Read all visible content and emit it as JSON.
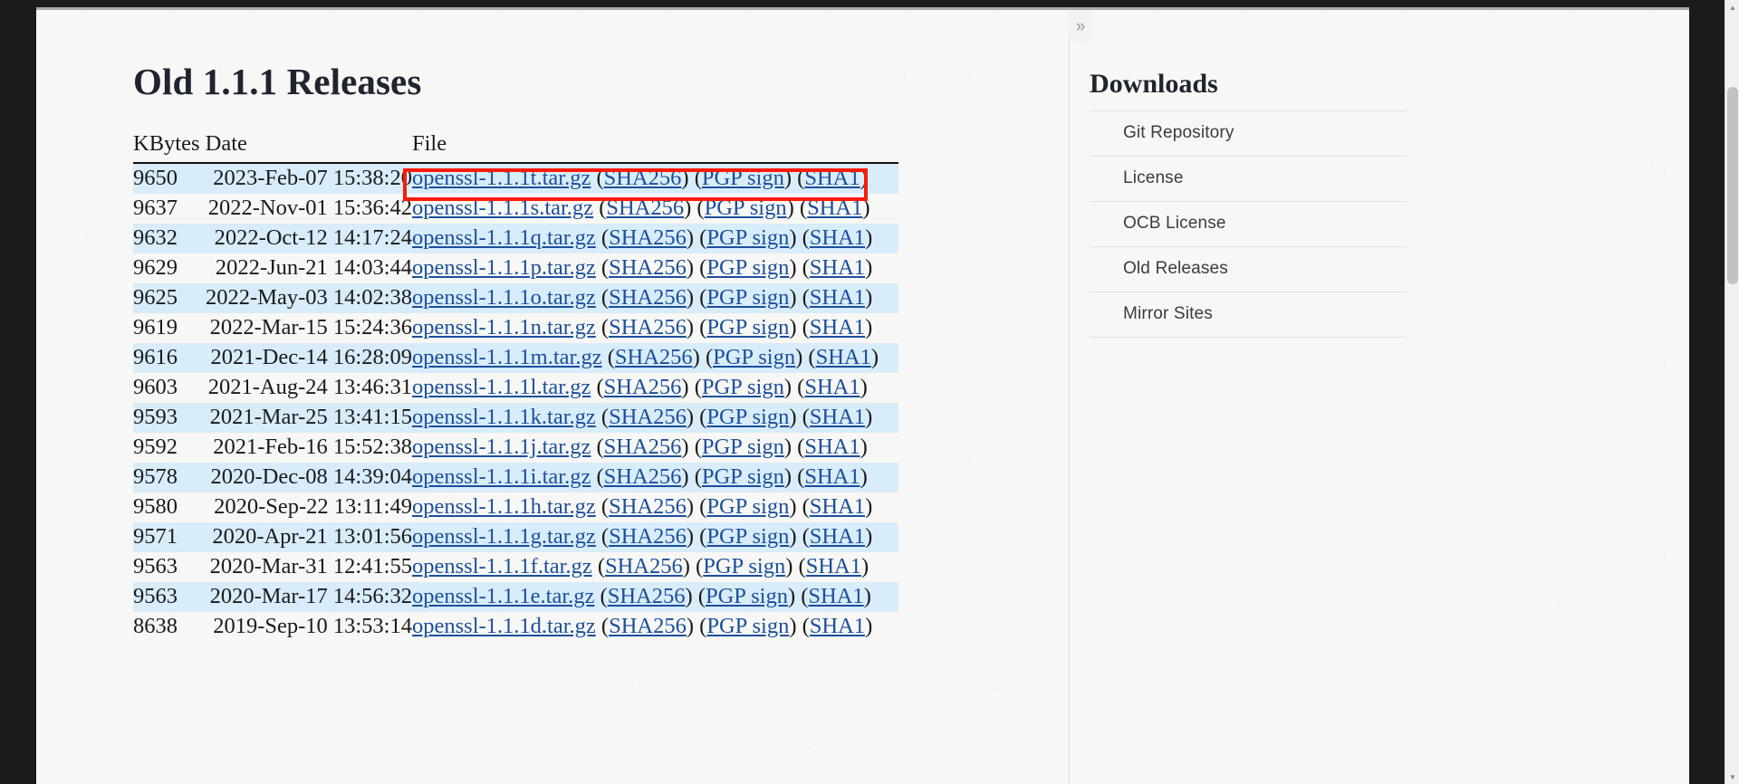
{
  "window": {
    "sidebar_toggle_glyph": "»",
    "scroll_up_glyph": "▲",
    "scroll_down_glyph": "▼"
  },
  "main": {
    "title": "Old 1.1.1 Releases",
    "table": {
      "headers": {
        "kbytes_date": "KBytes Date",
        "file": "File"
      },
      "link_labels": {
        "sha256": "(SHA256)",
        "pgp_sign": "(PGP sign)",
        "sha1": "(SHA1)"
      },
      "rows": [
        {
          "kbytes": "9650",
          "date": "2023-Feb-07 15:38:20",
          "file": "openssl-1.1.1t.tar.gz"
        },
        {
          "kbytes": "9637",
          "date": "2022-Nov-01 15:36:42",
          "file": "openssl-1.1.1s.tar.gz"
        },
        {
          "kbytes": "9632",
          "date": "2022-Oct-12 14:17:24",
          "file": "openssl-1.1.1q.tar.gz"
        },
        {
          "kbytes": "9629",
          "date": "2022-Jun-21 14:03:44",
          "file": "openssl-1.1.1p.tar.gz"
        },
        {
          "kbytes": "9625",
          "date": "2022-May-03 14:02:38",
          "file": "openssl-1.1.1o.tar.gz"
        },
        {
          "kbytes": "9619",
          "date": "2022-Mar-15 15:24:36",
          "file": "openssl-1.1.1n.tar.gz"
        },
        {
          "kbytes": "9616",
          "date": "2021-Dec-14 16:28:09",
          "file": "openssl-1.1.1m.tar.gz"
        },
        {
          "kbytes": "9603",
          "date": "2021-Aug-24 13:46:31",
          "file": "openssl-1.1.1l.tar.gz"
        },
        {
          "kbytes": "9593",
          "date": "2021-Mar-25 13:41:15",
          "file": "openssl-1.1.1k.tar.gz"
        },
        {
          "kbytes": "9592",
          "date": "2021-Feb-16 15:52:38",
          "file": "openssl-1.1.1j.tar.gz"
        },
        {
          "kbytes": "9578",
          "date": "2020-Dec-08 14:39:04",
          "file": "openssl-1.1.1i.tar.gz"
        },
        {
          "kbytes": "9580",
          "date": "2020-Sep-22 13:11:49",
          "file": "openssl-1.1.1h.tar.gz"
        },
        {
          "kbytes": "9571",
          "date": "2020-Apr-21 13:01:56",
          "file": "openssl-1.1.1g.tar.gz"
        },
        {
          "kbytes": "9563",
          "date": "2020-Mar-31 12:41:55",
          "file": "openssl-1.1.1f.tar.gz"
        },
        {
          "kbytes": "9563",
          "date": "2020-Mar-17 14:56:32",
          "file": "openssl-1.1.1e.tar.gz"
        },
        {
          "kbytes": "8638",
          "date": "2019-Sep-10 13:53:14",
          "file": "openssl-1.1.1d.tar.gz"
        }
      ]
    }
  },
  "sidebar": {
    "title": "Downloads",
    "items": [
      {
        "label": "Git Repository"
      },
      {
        "label": "License"
      },
      {
        "label": "OCB License"
      },
      {
        "label": "Old Releases"
      },
      {
        "label": "Mirror Sites"
      }
    ]
  },
  "annotation": {
    "color": "#f91b09"
  }
}
